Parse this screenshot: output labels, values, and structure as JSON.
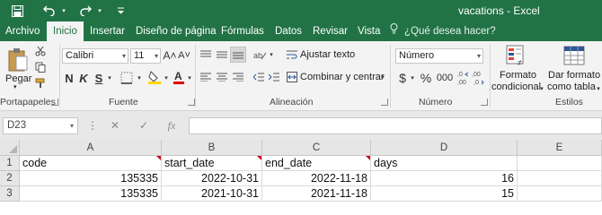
{
  "window": {
    "title": "vacations  -  Excel",
    "accent": "#217346"
  },
  "quick_access": {
    "save_icon": "save-icon",
    "undo_icon": "undo-icon",
    "redo_icon": "redo-icon",
    "customize_icon": "customize-dropdown-icon"
  },
  "ribbon_tabs": [
    "Archivo",
    "Inicio",
    "Insertar",
    "Diseño de página",
    "Fórmulas",
    "Datos",
    "Revisar",
    "Vista"
  ],
  "tell_me": "¿Qué desea hacer?",
  "ribbon": {
    "portapapeles": {
      "label": "Portapapeles",
      "paste_label": "Pegar"
    },
    "fuente": {
      "label": "Fuente",
      "font_name": "Calibri",
      "font_size": "11",
      "grow": "A˄",
      "shrink": "A˅",
      "bold": "N",
      "italic": "K",
      "underline": "S"
    },
    "alineacion": {
      "label": "Alineación",
      "wrap_text": "Ajustar texto",
      "merge_center": "Combinar y centrar"
    },
    "numero": {
      "label": "Número",
      "format": "Número",
      "currency": "$",
      "percent": "%",
      "thousands": "000"
    },
    "estilos": {
      "label": "Estilos",
      "conditional_format_line1": "Formato",
      "conditional_format_line2": "condicional",
      "format_table_line1": "Dar formato",
      "format_table_line2": "como tabla"
    }
  },
  "formula_bar": {
    "name_box": "D23",
    "cancel": "✕",
    "enter": "✓",
    "fx": "fx",
    "value": ""
  },
  "sheet": {
    "columns": [
      "A",
      "B",
      "C",
      "D",
      "E"
    ],
    "rows": [
      "1",
      "2",
      "3"
    ],
    "headers": [
      "code",
      "start_date",
      "end_date",
      "days"
    ],
    "data": [
      [
        "135335",
        "2022-10-31",
        "2022-11-18",
        "16"
      ],
      [
        "135335",
        "2021-10-31",
        "2021-11-18",
        "15"
      ]
    ]
  }
}
